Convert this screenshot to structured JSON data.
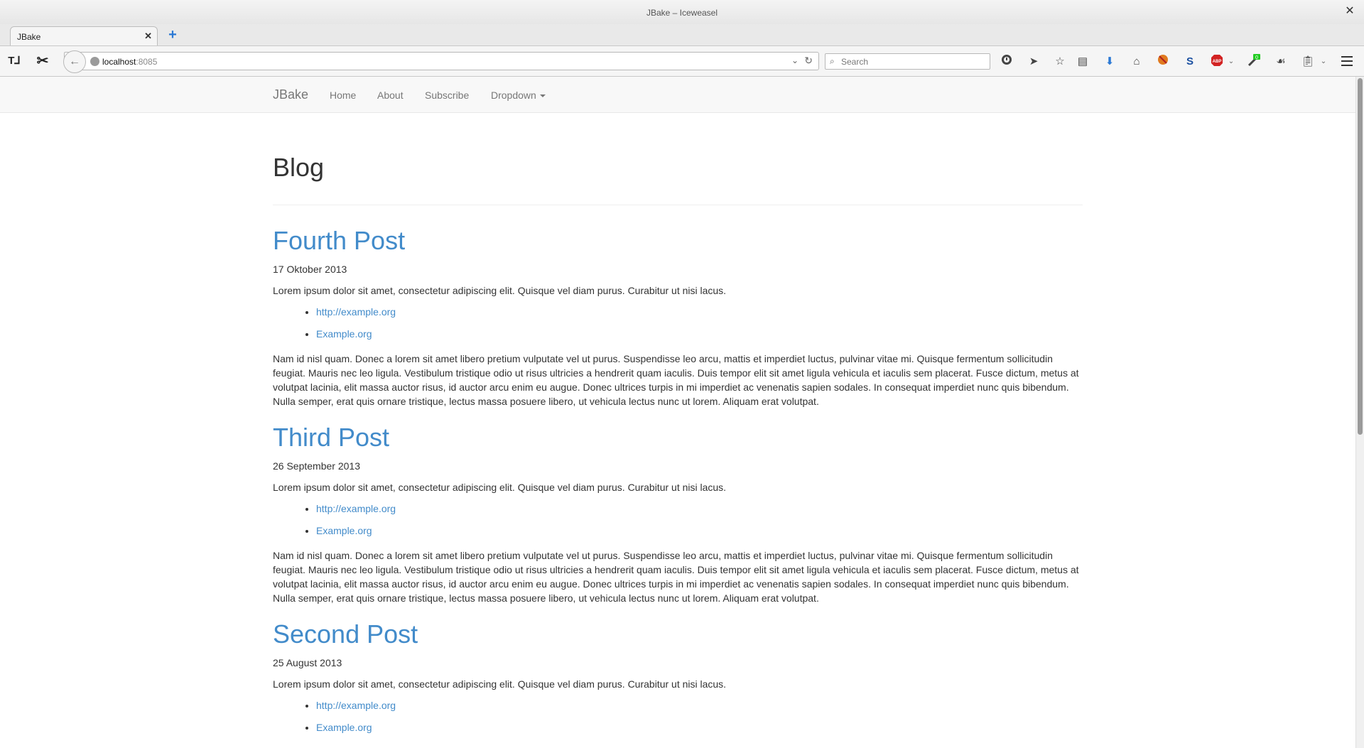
{
  "window": {
    "title": "JBake – Iceweasel"
  },
  "tabs": [
    {
      "label": "JBake"
    }
  ],
  "urlbar": {
    "host": "localhost",
    "port": ":8085"
  },
  "search": {
    "placeholder": "Search"
  },
  "site": {
    "brand": "JBake",
    "nav": [
      {
        "label": "Home"
      },
      {
        "label": "About"
      },
      {
        "label": "Subscribe"
      },
      {
        "label": "Dropdown"
      }
    ]
  },
  "page": {
    "title": "Blog"
  },
  "posts": [
    {
      "title": "Fourth Post",
      "date": "17 Oktober 2013",
      "intro": "Lorem ipsum dolor sit amet, consectetur adipiscing elit. Quisque vel diam purus. Curabitur ut nisi lacus.",
      "links": [
        "http://example.org",
        "Example.org"
      ],
      "body": "Nam id nisl quam. Donec a lorem sit amet libero pretium vulputate vel ut purus. Suspendisse leo arcu, mattis et imperdiet luctus, pulvinar vitae mi. Quisque fermentum sollicitudin feugiat. Mauris nec leo ligula. Vestibulum tristique odio ut risus ultricies a hendrerit quam iaculis. Duis tempor elit sit amet ligula vehicula et iaculis sem placerat. Fusce dictum, metus at volutpat lacinia, elit massa auctor risus, id auctor arcu enim eu augue. Donec ultrices turpis in mi imperdiet ac venenatis sapien sodales. In consequat imperdiet nunc quis bibendum. Nulla semper, erat quis ornare tristique, lectus massa posuere libero, ut vehicula lectus nunc ut lorem. Aliquam erat volutpat."
    },
    {
      "title": "Third Post",
      "date": "26 September 2013",
      "intro": "Lorem ipsum dolor sit amet, consectetur adipiscing elit. Quisque vel diam purus. Curabitur ut nisi lacus.",
      "links": [
        "http://example.org",
        "Example.org"
      ],
      "body": "Nam id nisl quam. Donec a lorem sit amet libero pretium vulputate vel ut purus. Suspendisse leo arcu, mattis et imperdiet luctus, pulvinar vitae mi. Quisque fermentum sollicitudin feugiat. Mauris nec leo ligula. Vestibulum tristique odio ut risus ultricies a hendrerit quam iaculis. Duis tempor elit sit amet ligula vehicula et iaculis sem placerat. Fusce dictum, metus at volutpat lacinia, elit massa auctor risus, id auctor arcu enim eu augue. Donec ultrices turpis in mi imperdiet ac venenatis sapien sodales. In consequat imperdiet nunc quis bibendum. Nulla semper, erat quis ornare tristique, lectus massa posuere libero, ut vehicula lectus nunc ut lorem. Aliquam erat volutpat."
    },
    {
      "title": "Second Post",
      "date": "25 August 2013",
      "intro": "Lorem ipsum dolor sit amet, consectetur adipiscing elit. Quisque vel diam purus. Curabitur ut nisi lacus.",
      "links": [
        "http://example.org",
        "Example.org"
      ],
      "body": ""
    }
  ],
  "toolbar_icons": [
    "history-icon",
    "send-icon",
    "bookmark-star-icon",
    "reading-list-icon",
    "download-icon",
    "home-icon",
    "blocked-icon",
    "s-extension-icon",
    "adblock-icon",
    "greasemonkey-icon",
    "puzzle-extension-icon",
    "clipboard-icon"
  ],
  "colors": {
    "link": "#428bca",
    "text": "#333333",
    "nav_text": "#777777",
    "nav_bg": "#f8f8f8",
    "adblock_red": "#d22222",
    "badge_green": "#22cc22"
  },
  "badges": {
    "greasemonkey": "0"
  }
}
